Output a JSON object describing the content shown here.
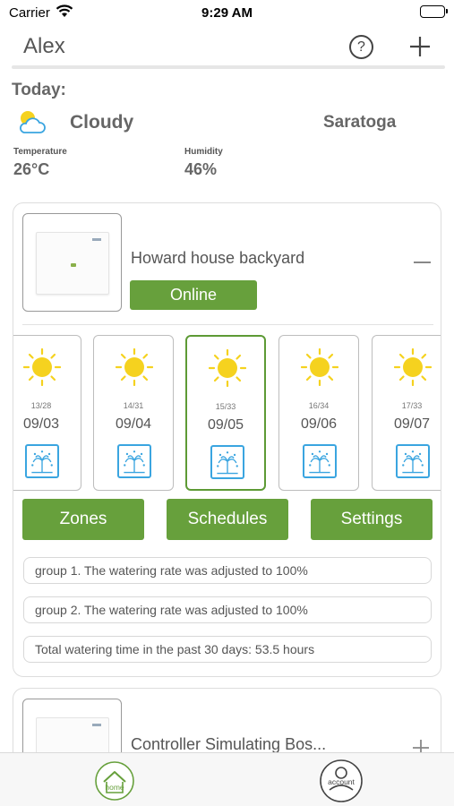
{
  "status_bar": {
    "carrier": "Carrier",
    "time": "9:29 AM"
  },
  "header": {
    "title": "Alex",
    "help_label": "?"
  },
  "weather": {
    "today_label": "Today:",
    "condition": "Cloudy",
    "city": "Saratoga",
    "temperature_label": "Temperature",
    "temperature": "26°C",
    "humidity_label": "Humidity",
    "humidity": "46%"
  },
  "devices": [
    {
      "name": "Howard house backyard",
      "status": "Online",
      "forecast": [
        {
          "range": "13/28",
          "date": "09/03",
          "selected": false
        },
        {
          "range": "14/31",
          "date": "09/04",
          "selected": false
        },
        {
          "range": "15/33",
          "date": "09/05",
          "selected": true
        },
        {
          "range": "16/34",
          "date": "09/06",
          "selected": false
        },
        {
          "range": "17/33",
          "date": "09/07",
          "selected": false
        }
      ],
      "actions": [
        "Zones",
        "Schedules",
        "Settings"
      ],
      "messages": [
        "group 1. The watering rate was adjusted to 100%",
        "group 2. The watering rate was adjusted to 100%",
        "Total watering time in the past 30 days: 53.5 hours"
      ]
    },
    {
      "name": "Controller Simulating Bos..."
    }
  ],
  "tabs": {
    "home": "home",
    "account": "account"
  },
  "colors": {
    "accent": "#67a03c",
    "water": "#3aa5e0",
    "sun": "#f5d21f"
  }
}
